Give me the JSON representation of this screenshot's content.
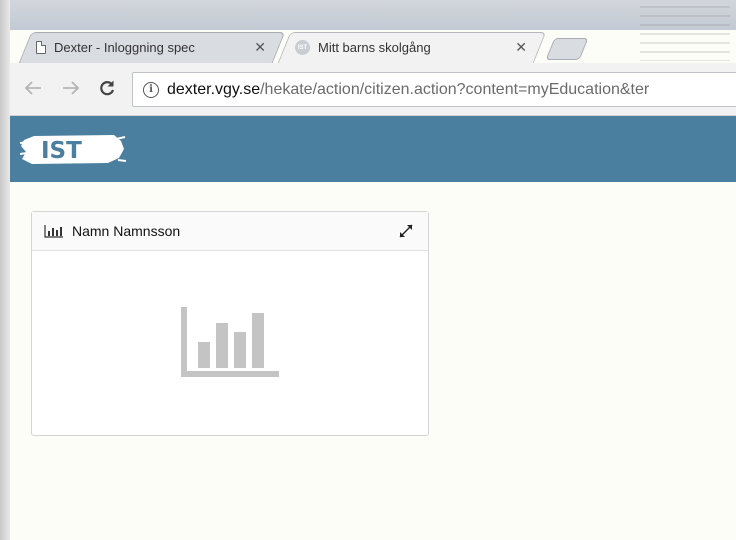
{
  "browser": {
    "tabs": [
      {
        "title": "Dexter - Inloggning spec",
        "active": false
      },
      {
        "title": "Mitt barns skolgång",
        "active": true
      }
    ],
    "url": {
      "host": "dexter.vgy.se",
      "path": "/hekate/action/citizen.action?content=myEducation&ter"
    }
  },
  "site": {
    "logo_text": "IST",
    "header_color": "#4a7fa0"
  },
  "widget": {
    "title": "Namn Namnsson",
    "title_icon": "bar-chart-icon",
    "expand_icon": "expand-icon",
    "placeholder_icon": "bar-chart-placeholder-icon"
  }
}
